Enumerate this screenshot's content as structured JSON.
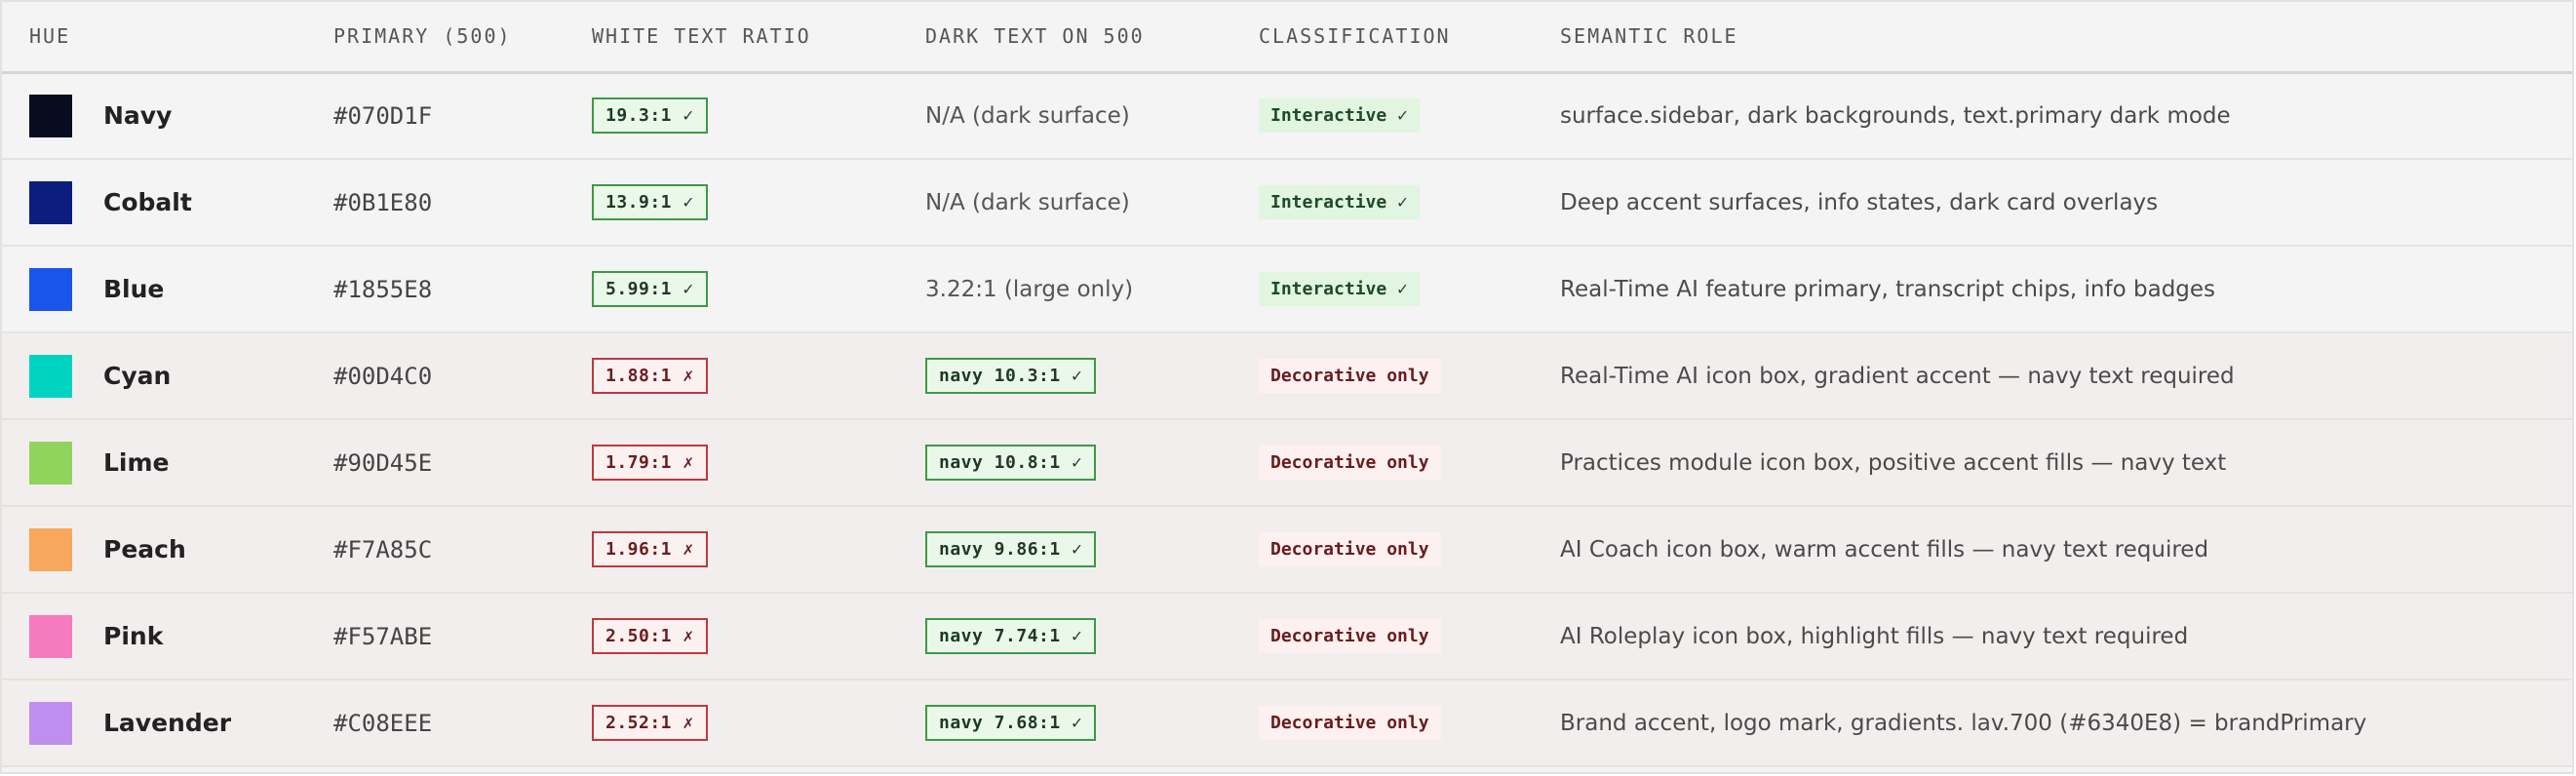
{
  "headers": {
    "hue": "HUE",
    "primary": "PRIMARY (500)",
    "white_ratio": "WHITE TEXT RATIO",
    "dark_text": "DARK TEXT ON 500",
    "classification": "CLASSIFICATION",
    "semantic_role": "SEMANTIC ROLE"
  },
  "colors": {
    "interactive_row_bg": "#f4f4f4",
    "decorative_row_bg": "#f3eeee",
    "pass_border": "#3c9a45",
    "fail_border": "#c0393b"
  },
  "rows": [
    {
      "name": "Navy",
      "swatch": "#070D1F",
      "hex": "#070D1F",
      "white_ratio": "19.3:1 ✓",
      "white_pass": true,
      "dark_text": "N/A (dark surface)",
      "dark_is_badge": false,
      "classification": "Interactive ✓",
      "kind": "interactive",
      "role": "surface.sidebar, dark backgrounds, text.primary dark mode"
    },
    {
      "name": "Cobalt",
      "swatch": "#0B1E80",
      "hex": "#0B1E80",
      "white_ratio": "13.9:1 ✓",
      "white_pass": true,
      "dark_text": "N/A (dark surface)",
      "dark_is_badge": false,
      "classification": "Interactive ✓",
      "kind": "interactive",
      "role": "Deep accent surfaces, info states, dark card overlays"
    },
    {
      "name": "Blue",
      "swatch": "#1855E8",
      "hex": "#1855E8",
      "white_ratio": "5.99:1 ✓",
      "white_pass": true,
      "dark_text": "3.22:1 (large only)",
      "dark_is_badge": false,
      "classification": "Interactive ✓",
      "kind": "interactive",
      "role": "Real-Time AI feature primary, transcript chips, info badges"
    },
    {
      "name": "Cyan",
      "swatch": "#00D4C0",
      "hex": "#00D4C0",
      "white_ratio": "1.88:1 ✗",
      "white_pass": false,
      "dark_text": "navy 10.3:1 ✓",
      "dark_is_badge": true,
      "classification": "Decorative only",
      "kind": "decorative",
      "role": "Real-Time AI icon box, gradient accent — navy text required"
    },
    {
      "name": "Lime",
      "swatch": "#90D45E",
      "hex": "#90D45E",
      "white_ratio": "1.79:1 ✗",
      "white_pass": false,
      "dark_text": "navy 10.8:1 ✓",
      "dark_is_badge": true,
      "classification": "Decorative only",
      "kind": "decorative",
      "role": "Practices module icon box, positive accent fills — navy text"
    },
    {
      "name": "Peach",
      "swatch": "#F7A85C",
      "hex": "#F7A85C",
      "white_ratio": "1.96:1 ✗",
      "white_pass": false,
      "dark_text": "navy 9.86:1 ✓",
      "dark_is_badge": true,
      "classification": "Decorative only",
      "kind": "decorative",
      "role": "AI Coach icon box, warm accent fills — navy text required"
    },
    {
      "name": "Pink",
      "swatch": "#F57ABE",
      "hex": "#F57ABE",
      "white_ratio": "2.50:1 ✗",
      "white_pass": false,
      "dark_text": "navy 7.74:1 ✓",
      "dark_is_badge": true,
      "classification": "Decorative only",
      "kind": "decorative",
      "role": "AI Roleplay icon box, highlight fills — navy text required"
    },
    {
      "name": "Lavender",
      "swatch": "#C08EEE",
      "hex": "#C08EEE",
      "white_ratio": "2.52:1 ✗",
      "white_pass": false,
      "dark_text": "navy 7.68:1 ✓",
      "dark_is_badge": true,
      "classification": "Decorative only",
      "kind": "decorative",
      "role": "Brand accent, logo mark, gradients. lav.700 (#6340E8) = brandPrimary"
    }
  ]
}
